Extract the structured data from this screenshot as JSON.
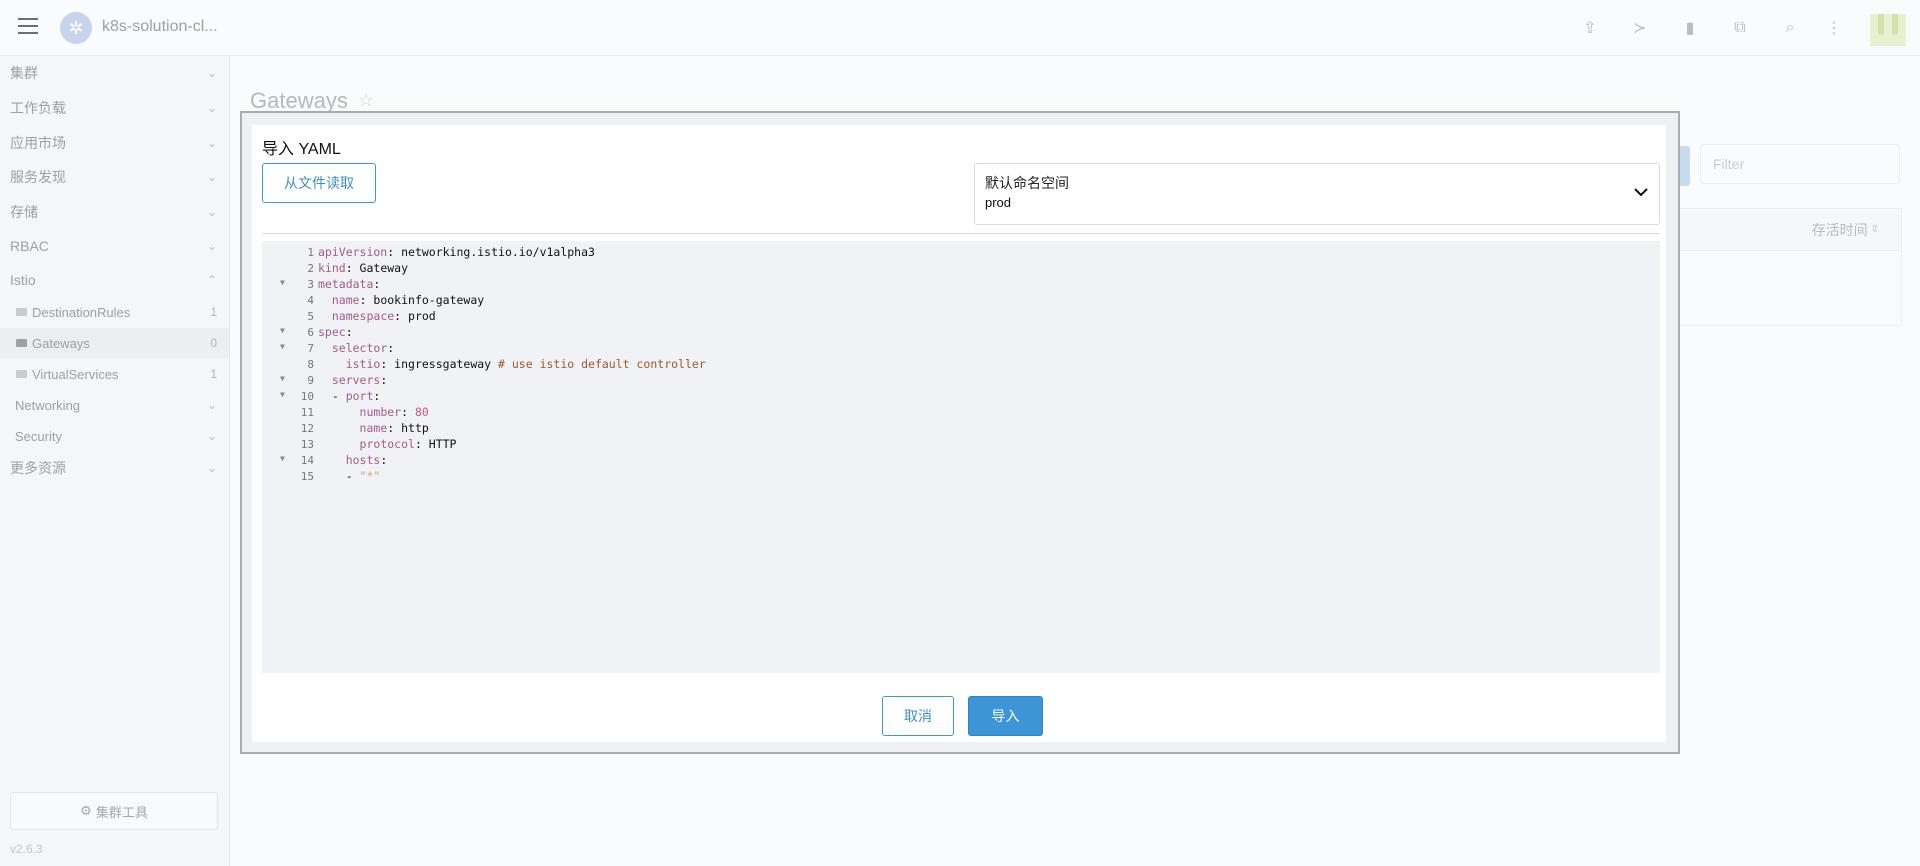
{
  "header": {
    "cluster_name": "k8s-solution-cl...",
    "icons": [
      "menu-icon",
      "upload-icon",
      "terminal-icon",
      "file-icon",
      "copy-icon",
      "search-icon",
      "more-vertical-icon"
    ]
  },
  "sidebar": {
    "items": [
      {
        "label": "集群",
        "expanded": false
      },
      {
        "label": "工作负载",
        "expanded": false
      },
      {
        "label": "应用市场",
        "expanded": false
      },
      {
        "label": "服务发现",
        "expanded": false
      },
      {
        "label": "存储",
        "expanded": false
      },
      {
        "label": "RBAC",
        "expanded": false
      },
      {
        "label": "Istio",
        "expanded": true
      },
      {
        "label": "Networking",
        "expanded": false
      },
      {
        "label": "Security",
        "expanded": false
      },
      {
        "label": "更多资源",
        "expanded": false
      }
    ],
    "istio_children": [
      {
        "label": "DestinationRules",
        "count": "1"
      },
      {
        "label": "Gateways",
        "count": "0"
      },
      {
        "label": "VirtualServices",
        "count": "1"
      }
    ],
    "tools_label": "集群工具",
    "version": "v2.6.3"
  },
  "main": {
    "title": "Gateways",
    "filter_placeholder": "Filter",
    "table_header_age": "存活时间"
  },
  "modal": {
    "title": "导入 YAML",
    "file_button": "从文件读取",
    "namespace_label": "默认命名空间",
    "namespace_value": "prod",
    "cancel_label": "取消",
    "import_label": "导入",
    "yaml_lines": [
      "apiVersion: networking.istio.io/v1alpha3",
      "kind: Gateway",
      "metadata:",
      "  name: bookinfo-gateway",
      "  namespace: prod",
      "spec:",
      "  selector:",
      "    istio: ingressgateway # use istio default controller",
      "  servers:",
      "  - port:",
      "      number: 80",
      "      name: http",
      "      protocol: HTTP",
      "    hosts:",
      "    - \"*\""
    ]
  },
  "colors": {
    "primary": "#3b95d6",
    "primary_text": "#3d8fc7",
    "yaml_key": "#a35a8e",
    "yaml_comment": "#9a5a27",
    "yaml_string": "#e0a25b"
  }
}
